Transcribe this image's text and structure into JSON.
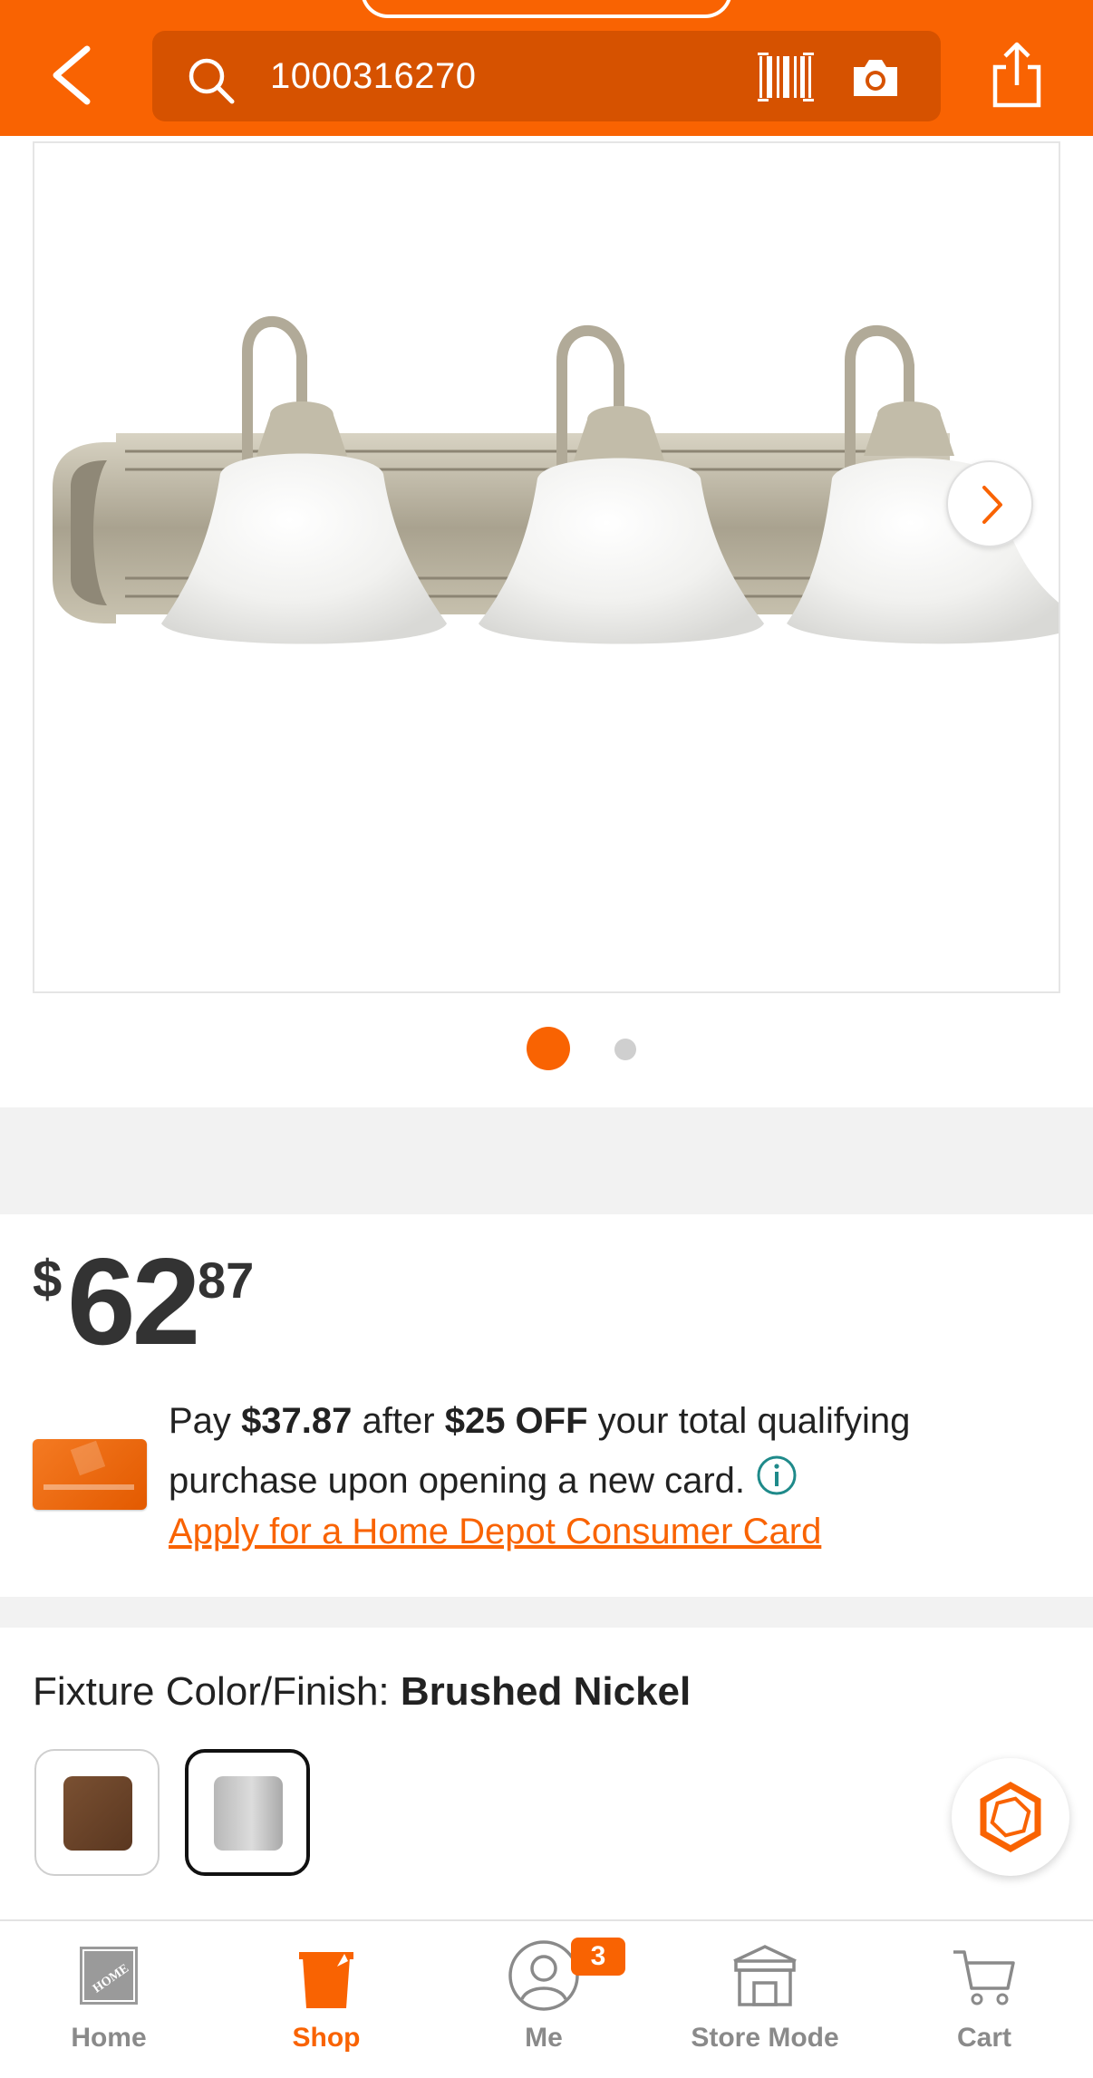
{
  "colors": {
    "brand": "#f96302",
    "search_bg": "#d65200",
    "text": "#222222",
    "muted": "#8a8a8a"
  },
  "header": {
    "search_value": "1000316270",
    "icons": [
      "chevron-left-icon",
      "search-icon",
      "barcode-icon",
      "camera-icon",
      "share-icon"
    ]
  },
  "gallery": {
    "image_description_icon": "vanity-light-fixture-image",
    "current_image": 1,
    "image_count": 2
  },
  "price": {
    "currency": "$",
    "dollars": "62",
    "cents": "87"
  },
  "promo": {
    "pay_prefix": "Pay",
    "amount": "$37.87",
    "after": "after",
    "discount": "$25 OFF",
    "rest_line1": "your total qualifying",
    "line2": "purchase upon opening a new card.",
    "apply_link": "Apply for a Home Depot Consumer Card"
  },
  "finish": {
    "label": "Fixture Color/Finish:",
    "selected": "Brushed Nickel",
    "options": [
      "Bronze",
      "Brushed Nickel"
    ]
  },
  "bottom_nav": {
    "items": [
      {
        "label": "Home",
        "icon": "home-depot-logo-icon",
        "active": false
      },
      {
        "label": "Shop",
        "icon": "bucket-icon",
        "active": true
      },
      {
        "label": "Me",
        "icon": "user-icon",
        "active": false,
        "badge": "3"
      },
      {
        "label": "Store Mode",
        "icon": "store-icon",
        "active": false
      },
      {
        "label": "Cart",
        "icon": "cart-icon",
        "active": false
      }
    ]
  }
}
